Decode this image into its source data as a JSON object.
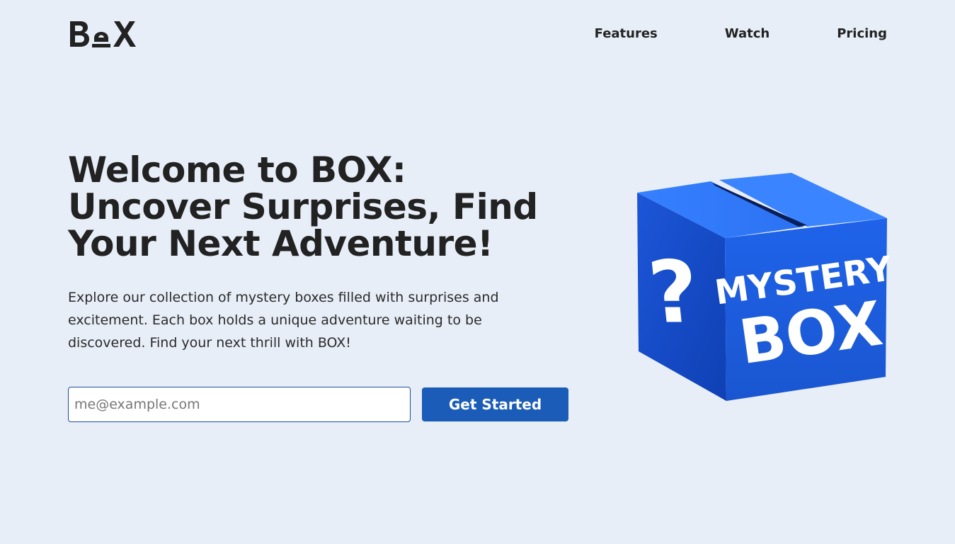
{
  "brand": {
    "logo_text": "BOX"
  },
  "nav": {
    "items": [
      {
        "label": "Features"
      },
      {
        "label": "Watch"
      },
      {
        "label": "Pricing"
      }
    ]
  },
  "hero": {
    "title": "Welcome to BOX: Uncover Surprises, Find Your Next Adventure!",
    "subtitle": "Explore our collection of mystery boxes filled with surprises and excitement. Each box holds a unique adventure waiting to be discovered. Find your next thrill with BOX!",
    "email_placeholder": "me@example.com",
    "email_value": "",
    "cta_label": "Get Started"
  },
  "illustration": {
    "line1": "MYSTERY",
    "line2": "BOX",
    "symbol": "?",
    "icon": "mystery-box-illustration"
  },
  "colors": {
    "background": "#e8eef8",
    "accent": "#1b5cb8",
    "box_blue": "#1f63e8",
    "text": "#222222"
  }
}
